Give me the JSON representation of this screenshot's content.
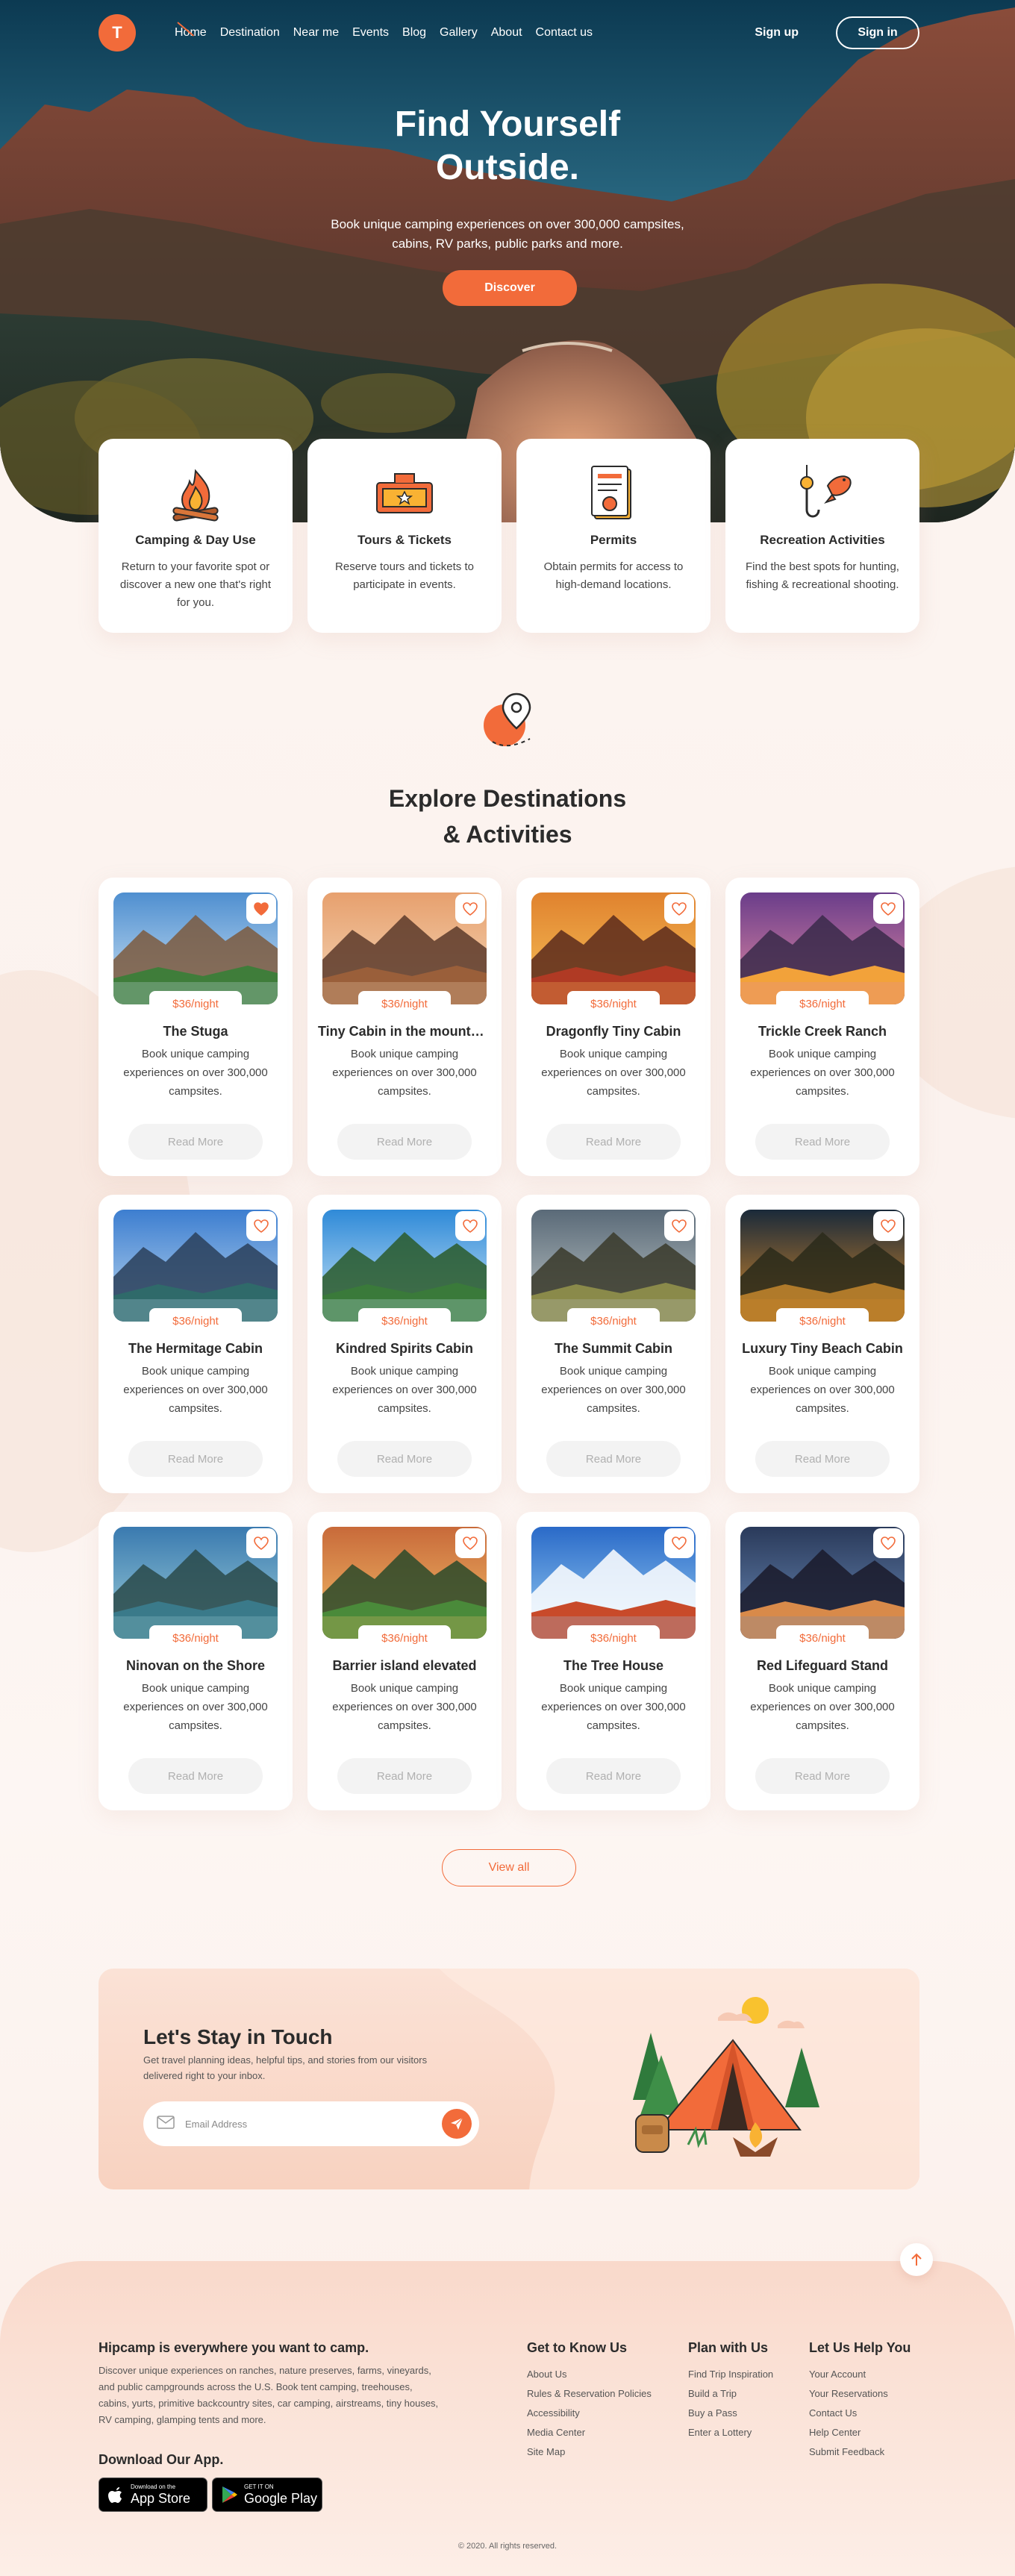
{
  "nav": {
    "logo": "T",
    "links": [
      "Home",
      "Destination",
      "Near me",
      "Events",
      "Blog",
      "Gallery",
      "About",
      "Contact us"
    ],
    "signup": "Sign up",
    "signin": "Sign in"
  },
  "hero": {
    "title_line1": "Find Yourself",
    "title_line2": "Outside.",
    "subtitle": "Book unique camping experiences on over 300,000 campsites, cabins, RV parks, public parks and more.",
    "cta": "Discover"
  },
  "features": [
    {
      "icon": "campfire-icon",
      "title": "Camping & Day Use",
      "text": "Return to your favorite spot or discover a new one that's right for you."
    },
    {
      "icon": "ticket-icon",
      "title": "Tours & Tickets",
      "text": "Reserve tours and tickets to participate in events."
    },
    {
      "icon": "permit-document-icon",
      "title": "Permits",
      "text": "Obtain permits for access to high-demand locations."
    },
    {
      "icon": "fishing-hook-icon",
      "title": "Recreation Activities",
      "text": "Find the best spots for hunting, fishing & recreational shooting."
    }
  ],
  "explore": {
    "icon": "location-pin-icon",
    "title_line1": "Explore Destinations",
    "title_line2": "& Activities",
    "read_more": "Read More",
    "view_all": "View all",
    "destinations": [
      {
        "name": "The Stuga",
        "price": "$36/night",
        "desc": "Book unique camping experiences on over 300,000 campsites.",
        "liked": true
      },
      {
        "name": "Tiny Cabin in the mountains",
        "price": "$36/night",
        "desc": "Book unique camping experiences on over 300,000 campsites.",
        "liked": false
      },
      {
        "name": "Dragonfly Tiny Cabin",
        "price": "$36/night",
        "desc": "Book unique camping experiences on over 300,000 campsites.",
        "liked": false
      },
      {
        "name": "Trickle Creek Ranch",
        "price": "$36/night",
        "desc": "Book unique camping experiences on over 300,000 campsites.",
        "liked": false
      },
      {
        "name": "The Hermitage Cabin",
        "price": "$36/night",
        "desc": "Book unique camping experiences on over 300,000 campsites.",
        "liked": false
      },
      {
        "name": "Kindred Spirits Cabin",
        "price": "$36/night",
        "desc": "Book unique camping experiences on over 300,000 campsites.",
        "liked": false
      },
      {
        "name": "The Summit Cabin",
        "price": "$36/night",
        "desc": "Book unique camping experiences on over 300,000 campsites.",
        "liked": false
      },
      {
        "name": "Luxury Tiny Beach Cabin",
        "price": "$36/night",
        "desc": "Book unique camping experiences on over 300,000 campsites.",
        "liked": false
      },
      {
        "name": "Ninovan on the Shore",
        "price": "$36/night",
        "desc": "Book unique camping experiences on over 300,000 campsites.",
        "liked": false
      },
      {
        "name": "Barrier island elevated",
        "price": "$36/night",
        "desc": "Book unique camping experiences on over 300,000 campsites.",
        "liked": false
      },
      {
        "name": "The Tree House",
        "price": "$36/night",
        "desc": "Book unique camping experiences on over 300,000 campsites.",
        "liked": false
      },
      {
        "name": "Red Lifeguard Stand",
        "price": "$36/night",
        "desc": "Book unique camping experiences on over 300,000 campsites.",
        "liked": false
      }
    ]
  },
  "newsletter": {
    "title": "Let's Stay in Touch",
    "subtitle": "Get travel planning ideas, helpful tips, and stories from our visitors delivered right to your inbox.",
    "placeholder": "Email Address"
  },
  "footer": {
    "about_title": "Hipcamp is everywhere you want to camp.",
    "about_text": "Discover unique experiences on ranches, nature preserves, farms, vineyards, and public campgrounds across the U.S. Book tent camping, treehouses, cabins, yurts, primitive backcountry sites, car camping, airstreams, tiny houses, RV camping, glamping tents and more.",
    "download_title": "Download Our App.",
    "appstore_small": "Download on the",
    "appstore_big": "App Store",
    "googleplay_small": "GET IT ON",
    "googleplay_big": "Google Play",
    "columns": [
      {
        "title": "Get to Know Us",
        "links": [
          "About Us",
          "Rules & Reservation Policies",
          "Accessibility",
          "Media Center",
          "Site Map"
        ]
      },
      {
        "title": "Plan with Us",
        "links": [
          "Find Trip Inspiration",
          "Build a Trip",
          "Buy a Pass",
          "Enter a Lottery"
        ]
      },
      {
        "title": "Let Us Help You",
        "links": [
          "Your Account",
          "Your Reservations",
          "Contact Us",
          "Help Center",
          "Submit Feedback"
        ]
      }
    ],
    "copyright": "© 2020. All rights reserved."
  },
  "colors": {
    "accent": "#f26b3a",
    "text": "#2b2b2b",
    "background": "#fbf3ef"
  }
}
